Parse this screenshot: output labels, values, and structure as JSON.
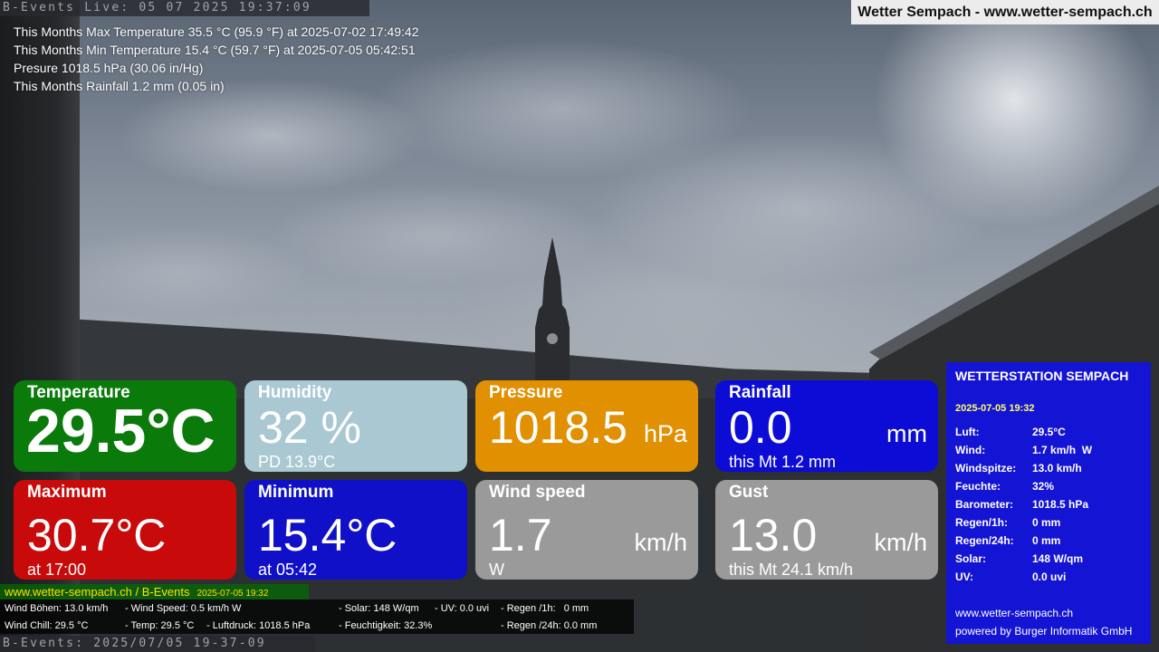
{
  "header": {
    "live_label": "B-Events Live: 05 07 2025 19:37:09",
    "site_title": "Wetter Sempach - www.wetter-sempach.ch"
  },
  "month_stats": {
    "max_temp": "This Months Max Temperature 35.5 °C (95.9 °F) at 2025-07-02 17:49:42",
    "min_temp": "This Months Min Temperature 15.4 °C (59.7 °F) at 2025-07-05 05:42:51",
    "pressure": "Presure 1018.5 hPa (30.06 in/Hg)",
    "rainfall": "This Months Rainfall 1.2 mm (0.05 in)"
  },
  "tiles": {
    "temperature": {
      "title": "Temperature",
      "value": "29.5°C",
      "color": "#0a7a0a"
    },
    "humidity": {
      "title": "Humidity",
      "value": "32 %",
      "sub": "PD 13.9°C",
      "color": "#a9c8d2"
    },
    "pressure": {
      "title": "Pressure",
      "value": "1018.5",
      "unit": "hPa",
      "color": "#e09000"
    },
    "rainfall": {
      "title": "Rainfall",
      "value": "0.0",
      "unit": "mm",
      "sub": "this Mt 1.2 mm",
      "color": "#0c0cd6"
    },
    "maximum": {
      "title": "Maximum",
      "value": "30.7°C",
      "sub": "at 17:00",
      "color": "#c80a0a"
    },
    "minimum": {
      "title": "Minimum",
      "value": "15.4°C",
      "sub": "at 05:42",
      "color": "#1010c8"
    },
    "wind_speed": {
      "title": "Wind speed",
      "value": "1.7",
      "unit": "km/h",
      "sub": "W",
      "color": "#9a9a9a"
    },
    "gust": {
      "title": "Gust",
      "value": "13.0",
      "unit": "km/h",
      "sub": "this Mt 24.1 km/h",
      "color": "#9a9a9a"
    }
  },
  "station": {
    "title": "WETTERSTATION SEMPACH",
    "timestamp": "2025-07-05 19:32",
    "rows": [
      {
        "label": "Luft:",
        "value": "29.5°C"
      },
      {
        "label": "Wind:",
        "value": "1.7 km/h  W"
      },
      {
        "label": "Windspitze:",
        "value": "13.0 km/h"
      },
      {
        "label": "Feuchte:",
        "value": "32%"
      },
      {
        "label": "Barometer:",
        "value": "1018.5 hPa"
      },
      {
        "label": "Regen/1h:",
        "value": "0 mm"
      },
      {
        "label": "Regen/24h:",
        "value": "0 mm"
      },
      {
        "label": "Solar:",
        "value": "148 W/qm"
      },
      {
        "label": "UV:",
        "value": "0.0 uvi"
      }
    ],
    "footer_url": "www.wetter-sempach.ch",
    "footer_credit": "powered by Burger Informatik GmbH",
    "background": "#1414d4"
  },
  "bottom": {
    "site_label": "www.wetter-sempach.ch / B-Events",
    "site_time": "2025-07-05 19:32",
    "line1": {
      "a": "Wind Böhen: 13.0 km/h",
      "b": "- Wind Speed: 0.5 km/h W",
      "c": "- Solar: 148 W/qm",
      "d": "- UV: 0.0 uvi",
      "e": "- Regen /1h:   0 mm"
    },
    "line2": {
      "a": "Wind Chill: 29.5 °C",
      "b": "- Temp: 29.5 °C",
      "c": "- Luftdruck: 1018.5 hPa",
      "d": "- Feuchtigkeit: 32.3%",
      "e": "- Regen /24h: 0.0 mm"
    },
    "footer_label": "B-Events: 2025/07/05 19-37-09"
  }
}
